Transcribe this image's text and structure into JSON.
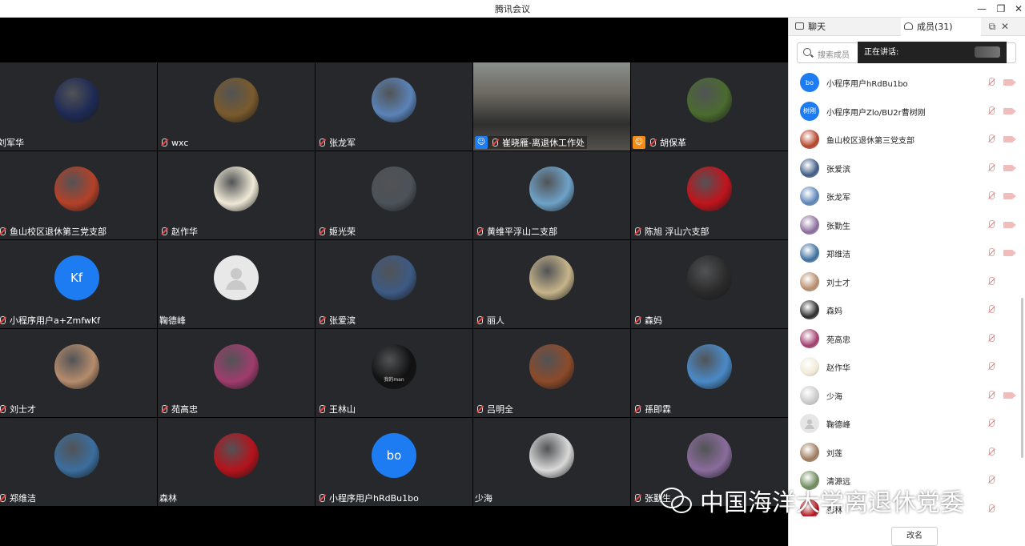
{
  "window": {
    "title": "腾讯会议",
    "minimize": "—",
    "restore": "❐",
    "close": "✕"
  },
  "tiles": [
    {
      "name": "刘军华",
      "mic": false,
      "avatar": "circle-logo",
      "color": "#1e2a55"
    },
    {
      "name": "wxc",
      "mic": true,
      "avatar": "sunset",
      "color": "#7a5a2c"
    },
    {
      "name": "张龙军",
      "mic": true,
      "avatar": "tree-sky",
      "color": "#5a83b8"
    },
    {
      "name": "崔晓雁-离退休工作处",
      "mic": true,
      "avatar": "video",
      "color": "#6d6a62",
      "badge": "blue"
    },
    {
      "name": "胡保革",
      "mic": true,
      "avatar": "red-jeep",
      "color": "#4a6b2e",
      "badge": "orange"
    },
    {
      "name": "鱼山校区退休第三党支部",
      "mic": true,
      "avatar": "red-trees",
      "color": "#b44128"
    },
    {
      "name": "赵作华",
      "mic": true,
      "avatar": "calligraphy",
      "color": "#efe9d6"
    },
    {
      "name": "姬光荣",
      "mic": true,
      "avatar": "window-plant",
      "color": "#4b5258"
    },
    {
      "name": "黄维平浮山二支部",
      "mic": true,
      "avatar": "bridge",
      "color": "#6ea2c8"
    },
    {
      "name": "陈旭 浮山六支部",
      "mic": true,
      "avatar": "red-art",
      "color": "#c0141c"
    },
    {
      "name": "小程序用户a+ZmfwKf",
      "mic": true,
      "avatar": "letter",
      "letter": "Kf",
      "color": "#1d7cf2"
    },
    {
      "name": "鞠德峰",
      "mic": false,
      "avatar": "gray",
      "color": "#e8e8e8"
    },
    {
      "name": "张爱滨",
      "mic": true,
      "avatar": "clouds",
      "color": "#3d5a84"
    },
    {
      "name": "丽人",
      "mic": true,
      "avatar": "sunflower",
      "color": "#c6b48a"
    },
    {
      "name": "森妈",
      "mic": true,
      "avatar": "sunglasses",
      "color": "#2a2a2a"
    },
    {
      "name": "刘士才",
      "mic": true,
      "avatar": "portrait",
      "color": "#b68c6c"
    },
    {
      "name": "苑高忠",
      "mic": true,
      "avatar": "planet",
      "color": "#a03c6e"
    },
    {
      "name": "王林山",
      "mic": true,
      "avatar": "dark-man",
      "color": "#111111",
      "caption": "我的man"
    },
    {
      "name": "吕明全",
      "mic": true,
      "avatar": "room",
      "color": "#8c4a2a"
    },
    {
      "name": "孫即霖",
      "mic": true,
      "avatar": "santorini",
      "color": "#4a8ac8"
    },
    {
      "name": "郑维洁",
      "mic": true,
      "avatar": "van-gogh",
      "color": "#3b6e9e"
    },
    {
      "name": "森林",
      "mic": false,
      "avatar": "red-forest",
      "color": "#b5121b"
    },
    {
      "name": "小程序用户hRdBu1bo",
      "mic": true,
      "avatar": "letter",
      "letter": "bo",
      "color": "#1d7cf2"
    },
    {
      "name": "少海",
      "mic": false,
      "avatar": "sketch",
      "color": "#d9d9d9"
    },
    {
      "name": "张勤生",
      "mic": true,
      "avatar": "painting",
      "color": "#8a6c9c"
    }
  ],
  "panel": {
    "tab_chat": "聊天",
    "tab_members": "成员(31)",
    "popout": "⧉",
    "close": "✕",
    "search_placeholder": "搜索成员",
    "speaking_label": "正在讲话:",
    "rename_button": "改名",
    "members": [
      {
        "name": "小程序用户hRdBu1bo",
        "avatar": "letter",
        "letter": "bo",
        "color": "#1d7cf2",
        "cam": true
      },
      {
        "name": "小程序用户Zlo/BU2r曹树刚",
        "avatar": "letter",
        "letter": "树刚",
        "color": "#1d7cf2",
        "cam": true
      },
      {
        "name": "鱼山校区退休第三党支部",
        "avatar": "img",
        "color": "#b44128",
        "cam": true
      },
      {
        "name": "张爱滨",
        "avatar": "img",
        "color": "#3d5a84",
        "cam": true
      },
      {
        "name": "张龙军",
        "avatar": "img",
        "color": "#5a83b8",
        "cam": true
      },
      {
        "name": "张勤生",
        "avatar": "img",
        "color": "#8a6c9c",
        "cam": true
      },
      {
        "name": "郑维洁",
        "avatar": "img",
        "color": "#3b6e9e",
        "cam": true
      },
      {
        "name": "刘士才",
        "avatar": "img",
        "color": "#b68c6c",
        "cam": false
      },
      {
        "name": "森妈",
        "avatar": "img",
        "color": "#2a2a2a",
        "cam": false
      },
      {
        "name": "苑高忠",
        "avatar": "img",
        "color": "#a03c6e",
        "cam": false
      },
      {
        "name": "赵作华",
        "avatar": "img",
        "color": "#efe9d6",
        "cam": false
      },
      {
        "name": "少海",
        "avatar": "img",
        "color": "#c9c9c9",
        "cam": true
      },
      {
        "name": "鞠德峰",
        "avatar": "gray",
        "color": "#e6e6e6",
        "cam": false
      },
      {
        "name": "刘莲",
        "avatar": "img",
        "color": "#9c7a5a",
        "cam": false
      },
      {
        "name": "清源远",
        "avatar": "img",
        "color": "#6c8a5a",
        "cam": false
      },
      {
        "name": "森林",
        "avatar": "img",
        "color": "#b5121b",
        "cam": false
      }
    ]
  },
  "watermark": {
    "text": "中国海洋大学离退休党委"
  }
}
